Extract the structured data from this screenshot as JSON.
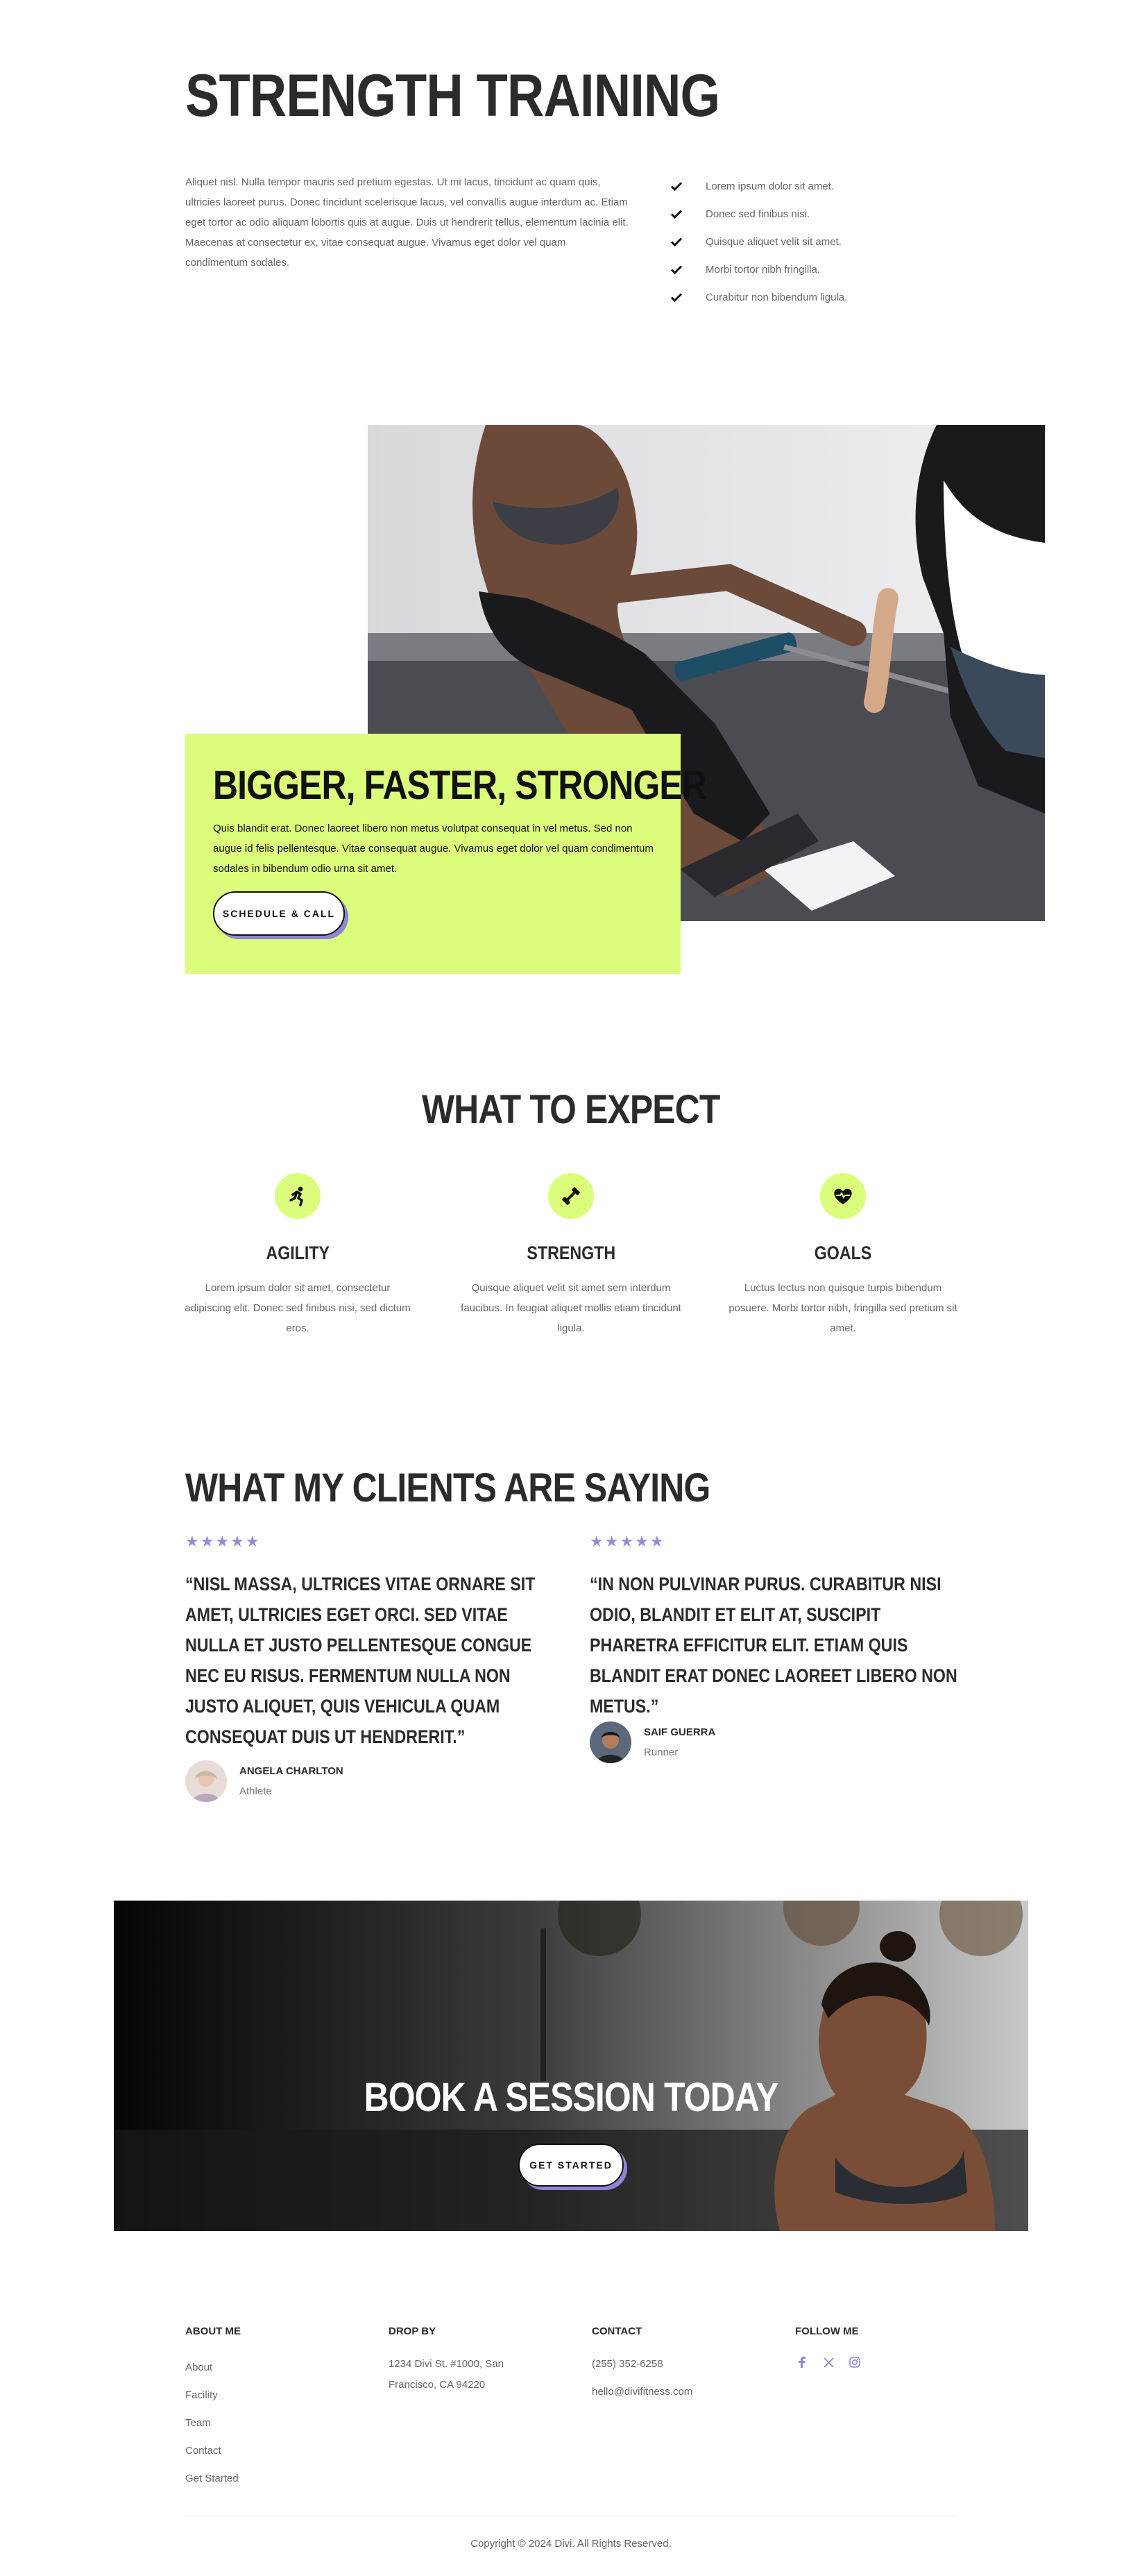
{
  "hero": {
    "title": "STRENGTH TRAINING",
    "text": "Aliquet nisl. Nulla tempor mauris sed pretium egestas. Ut mi lacus, tincidunt ac quam quis, ultricies laoreet purus. Donec tincidunt scelerisque lacus, vel convallis augue interdum ac. Etiam eget tortor ac odio aliquam lobortis quis at augue. Duis ut hendrerit tellus, elementum lacinia elit. Maecenas at consectetur ex, vitae consequat augue. Vivamus eget dolor vel quam condimentum sodales.",
    "checklist": [
      "Lorem ipsum dolor sit amet.",
      "Donec sed finibus nisi.",
      "Quisque aliquet velit sit amet.",
      "Morbi tortor nibh fringilla.",
      "Curabitur non bibendum ligula."
    ]
  },
  "cta": {
    "title": "BIGGER, FASTER, STRONGER",
    "text": "Quis blandit erat. Donec laoreet libero non metus volutpat consequat in vel metus. Sed non augue id felis pellentesque. Vitae consequat augue. Vivamus eget dolor vel quam condimentum sodales in bibendum odio urna sit amet.",
    "button": "SCHEDULE & CALL"
  },
  "expect": {
    "title": "WHAT TO EXPECT",
    "features": [
      {
        "icon": "running-person-icon",
        "title": "AGILITY",
        "text": "Lorem ipsum dolor sit amet, consectetur adipiscing elit. Donec sed finibus nisi, sed dictum eros."
      },
      {
        "icon": "dumbbell-icon",
        "title": "STRENGTH",
        "text": "Quisque aliquet velit sit amet sem interdum faucibus. In feugiat aliquet mollis etiam tincidunt ligula."
      },
      {
        "icon": "heart-rate-icon",
        "title": "GOALS",
        "text": "Luctus lectus non quisque turpis bibendum posuere. Morbi tortor nibh, fringilla sed pretium sit amet."
      }
    ]
  },
  "clients": {
    "title": "WHAT MY CLIENTS ARE SAYING",
    "stars": "★★★★★",
    "testimonials": [
      {
        "quote": "“NISL MASSA, ULTRICES VITAE ORNARE SIT AMET, ULTRICIES EGET ORCI. SED VITAE NULLA ET JUSTO PELLENTESQUE CONGUE NEC EU RISUS. FERMENTUM NULLA NON JUSTO ALIQUET, QUIS VEHICULA QUAM CONSEQUAT DUIS UT HENDRERIT.”",
        "name": "ANGELA CHARLTON",
        "role": "Athlete"
      },
      {
        "quote": "“IN NON PULVINAR PURUS. CURABITUR NISI ODIO, BLANDIT ET ELIT AT, SUSCIPIT PHARETRA EFFICITUR ELIT. ETIAM QUIS BLANDIT ERAT DONEC LAOREET LIBERO NON METUS.”",
        "name": "SAIF GUERRA",
        "role": "Runner"
      }
    ]
  },
  "banner": {
    "title": "BOOK A SESSION TODAY",
    "button": "GET STARTED"
  },
  "footer": {
    "about": {
      "heading": "ABOUT ME",
      "links": [
        "About",
        "Facility",
        "Team",
        "Contact",
        "Get Started"
      ]
    },
    "drop": {
      "heading": "DROP BY",
      "address": "1234 Divi St. #1000, San Francisco, CA 94220"
    },
    "contact": {
      "heading": "CONTACT",
      "phone": "(255) 352-6258",
      "email": "hello@divifitness.com"
    },
    "follow": {
      "heading": "FOLLOW ME",
      "icons": [
        "facebook-icon",
        "x-twitter-icon",
        "instagram-icon"
      ]
    },
    "copyright": "Copyright © 2024 Divi. All Rights Reserved."
  },
  "colors": {
    "accent": "#dcfc7c",
    "purple": "#8f84d6",
    "text": "#2b2b2b"
  }
}
